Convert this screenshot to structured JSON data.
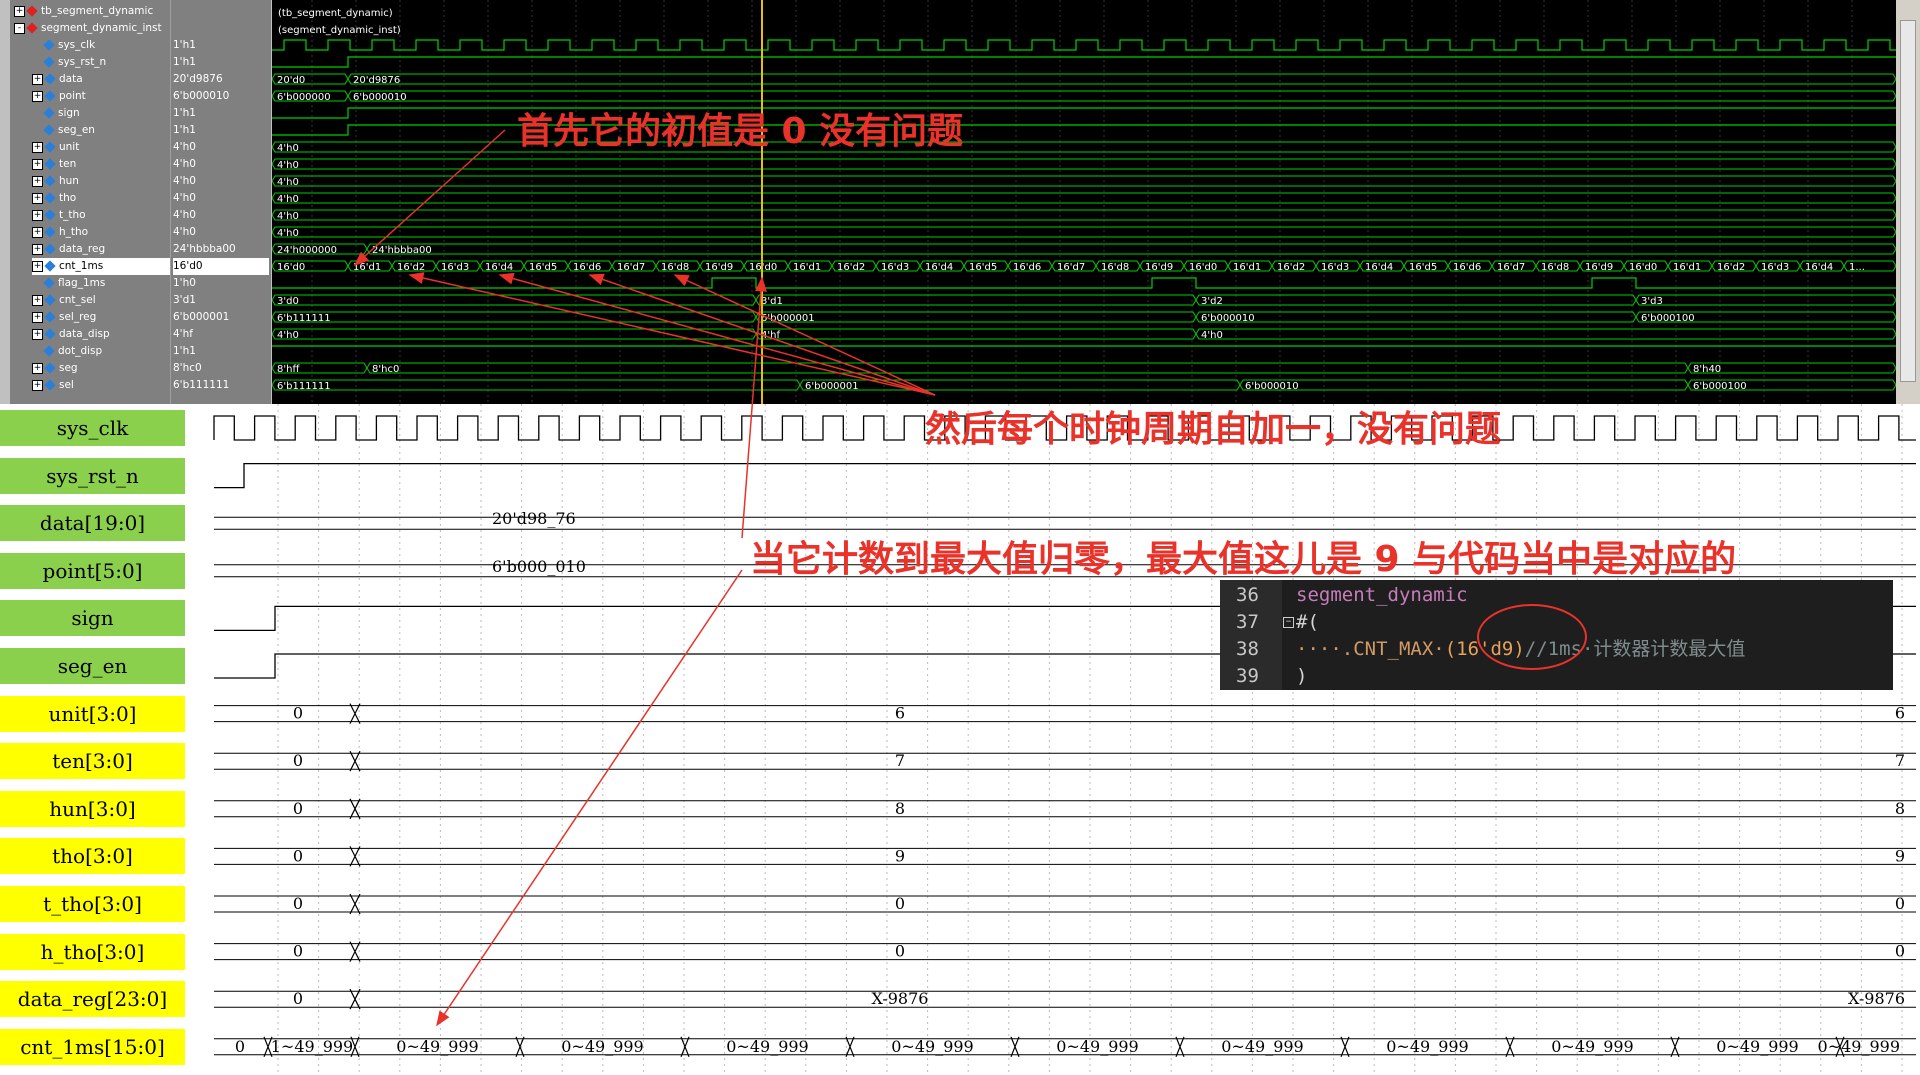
{
  "modelsim": {
    "signals": [
      {
        "name": "tb_segment_dynamic",
        "value": "",
        "icon": "red",
        "expand": "+",
        "indent": 0
      },
      {
        "name": "segment_dynamic_inst",
        "value": "",
        "icon": "red",
        "expand": "-",
        "indent": 0
      },
      {
        "name": "sys_clk",
        "value": "1'h1",
        "icon": "blue",
        "expand": "",
        "indent": 2
      },
      {
        "name": "sys_rst_n",
        "value": "1'h1",
        "icon": "blue",
        "expand": "",
        "indent": 2
      },
      {
        "name": "data",
        "value": "20'd9876",
        "icon": "blue",
        "expand": "+",
        "indent": 1
      },
      {
        "name": "point",
        "value": "6'b000010",
        "icon": "blue",
        "expand": "+",
        "indent": 1
      },
      {
        "name": "sign",
        "value": "1'h1",
        "icon": "blue",
        "expand": "",
        "indent": 2
      },
      {
        "name": "seg_en",
        "value": "1'h1",
        "icon": "blue",
        "expand": "",
        "indent": 2
      },
      {
        "name": "unit",
        "value": "4'h0",
        "icon": "blue",
        "expand": "+",
        "indent": 1
      },
      {
        "name": "ten",
        "value": "4'h0",
        "icon": "blue",
        "expand": "+",
        "indent": 1
      },
      {
        "name": "hun",
        "value": "4'h0",
        "icon": "blue",
        "expand": "+",
        "indent": 1
      },
      {
        "name": "tho",
        "value": "4'h0",
        "icon": "blue",
        "expand": "+",
        "indent": 1
      },
      {
        "name": "t_tho",
        "value": "4'h0",
        "icon": "blue",
        "expand": "+",
        "indent": 1
      },
      {
        "name": "h_tho",
        "value": "4'h0",
        "icon": "blue",
        "expand": "+",
        "indent": 1
      },
      {
        "name": "data_reg",
        "value": "24'hbbba00",
        "icon": "blue",
        "expand": "+",
        "indent": 1
      },
      {
        "name": "cnt_1ms",
        "value": "16'd0",
        "icon": "blue",
        "expand": "+",
        "indent": 1,
        "selected": true
      },
      {
        "name": "flag_1ms",
        "value": "1'h0",
        "icon": "blue",
        "expand": "",
        "indent": 2
      },
      {
        "name": "cnt_sel",
        "value": "3'd1",
        "icon": "blue",
        "expand": "+",
        "indent": 1
      },
      {
        "name": "sel_reg",
        "value": "6'b000001",
        "icon": "blue",
        "expand": "+",
        "indent": 1
      },
      {
        "name": "data_disp",
        "value": "4'hf",
        "icon": "blue",
        "expand": "+",
        "indent": 1
      },
      {
        "name": "dot_disp",
        "value": "1'h1",
        "icon": "blue",
        "expand": "",
        "indent": 2
      },
      {
        "name": "seg",
        "value": "8'hc0",
        "icon": "blue",
        "expand": "+",
        "indent": 1
      },
      {
        "name": "sel",
        "value": "6'b111111",
        "icon": "blue",
        "expand": "+",
        "indent": 1
      }
    ],
    "wave_header": [
      "(tb_segment_dynamic)",
      "(segment_dynamic_inst)"
    ],
    "bus_labels": {
      "data": [
        "20'd0",
        "20'd9876"
      ],
      "point": [
        "6'b000000",
        "6'b000010"
      ],
      "nibble": "4'h0",
      "data_reg": [
        "24'h000000",
        "24'hbbba00"
      ],
      "cnt_1ms": [
        "16'd0",
        "16'd1",
        "16'd2",
        "16'd3",
        "16'd4",
        "16'd5",
        "16'd6",
        "16'd7",
        "16'd8",
        "16'd9",
        "16'd0",
        "16'd1",
        "16'd2",
        "16'd3",
        "16'd4",
        "16'd5",
        "16'd6",
        "16'd7",
        "16'd8",
        "16'd9",
        "16'd0",
        "16'd1",
        "16'd2",
        "16'd3",
        "16'd4",
        "16'd5",
        "16'd6",
        "16'd7",
        "16'd8",
        "16'd9",
        "16'd0",
        "16'd1",
        "16'd2",
        "16'd3",
        "16'd4",
        "1..."
      ],
      "cnt_sel": [
        "3'd0",
        "3'd1",
        "3'd2",
        "3'd3"
      ],
      "sel_reg": [
        "6'b111111",
        "6'b000001",
        "6'b000010",
        "6'b000100"
      ],
      "data_disp": [
        "4'h0",
        "4'hf",
        "4'h0"
      ],
      "seg": [
        "8'hff",
        "8'hc0",
        "8'h40"
      ],
      "sel": [
        "6'b111111",
        "6'b000001",
        "6'b000010",
        "6'b000100"
      ]
    }
  },
  "lower": {
    "signals": [
      {
        "name": "sys_clk",
        "color": "green",
        "kind": "clock"
      },
      {
        "name": "sys_rst_n",
        "color": "green",
        "kind": "rst"
      },
      {
        "name": "data[19:0]",
        "color": "green",
        "kind": "bus1",
        "text": "20'd98_76"
      },
      {
        "name": "point[5:0]",
        "color": "green",
        "kind": "bus1",
        "text": "6'b000_010"
      },
      {
        "name": "sign",
        "color": "green",
        "kind": "bit"
      },
      {
        "name": "seg_en",
        "color": "green",
        "kind": "bit"
      },
      {
        "name": "unit[3:0]",
        "color": "yellow",
        "kind": "bus2",
        "init": "0",
        "val": "6"
      },
      {
        "name": "ten[3:0]",
        "color": "yellow",
        "kind": "bus2",
        "init": "0",
        "val": "7"
      },
      {
        "name": "hun[3:0]",
        "color": "yellow",
        "kind": "bus2",
        "init": "0",
        "val": "8"
      },
      {
        "name": "tho[3:0]",
        "color": "yellow",
        "kind": "bus2",
        "init": "0",
        "val": "9"
      },
      {
        "name": "t_tho[3:0]",
        "color": "yellow",
        "kind": "bus2",
        "init": "0",
        "val": "0"
      },
      {
        "name": "h_tho[3:0]",
        "color": "yellow",
        "kind": "bus2",
        "init": "0",
        "val": "0"
      },
      {
        "name": "data_reg[23:0]",
        "color": "yellow",
        "kind": "bus2",
        "init": "0",
        "val": "X-9876"
      },
      {
        "name": "cnt_1ms[15:0]",
        "color": "yellow",
        "kind": "cnt",
        "init": "0",
        "first": "1~49_999",
        "rest": "0~49_999"
      }
    ]
  },
  "annotations": {
    "a1": "首先它的初值是 0 没有问题",
    "a2": "然后每个时钟周期自加一，没有问题",
    "a3": "当它计数到最大值归零，最大值这儿是 9 与代码当中是对应的"
  },
  "code": {
    "lines": [
      {
        "n": "36",
        "text": "segment_dynamic"
      },
      {
        "n": "37",
        "text": "#("
      },
      {
        "n": "38",
        "text": "····.CNT_MAX·(16'd9)//1ms·计数器计数最大值"
      },
      {
        "n": "39",
        "text": ")"
      }
    ]
  },
  "colors": {
    "wave_green": "#00d000",
    "cursor": "#e8c000",
    "annotation": "#e8322a",
    "label_green": "#8bd04d",
    "label_yellow": "#ffff00"
  }
}
